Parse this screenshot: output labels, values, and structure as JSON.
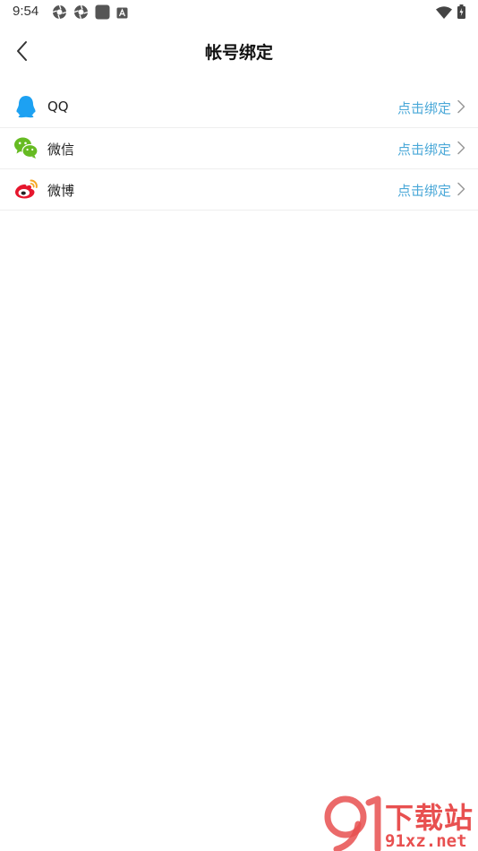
{
  "status_bar": {
    "time": "9:54",
    "left_icons": [
      "aperture-icon",
      "aperture-icon",
      "app-square-icon",
      "font-a-icon"
    ],
    "right_icons": [
      "wifi-icon",
      "battery-charging-icon"
    ]
  },
  "header": {
    "title": "帐号绑定",
    "back_icon": "chevron-left-icon"
  },
  "accounts": [
    {
      "label": "QQ",
      "action": "点击绑定",
      "icon": "qq-icon",
      "color": "#1da1f2"
    },
    {
      "label": "微信",
      "action": "点击绑定",
      "icon": "wechat-icon",
      "color": "#66bb22"
    },
    {
      "label": "微博",
      "action": "点击绑定",
      "icon": "weibo-icon",
      "color": "#e6162d"
    }
  ],
  "watermark": {
    "brand_text": "下载站",
    "url_text": "91xz.net",
    "logo_text": "9"
  },
  "colors": {
    "action_text": "#4aa8d8",
    "divider": "#eeeeee",
    "watermark": "#e85050"
  }
}
